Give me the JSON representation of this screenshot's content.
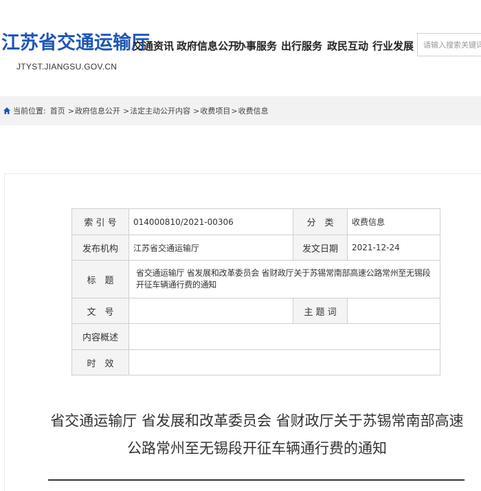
{
  "site": {
    "name": "江苏省交通运输厅",
    "domain": "JTYST.JIANGSU.GOV.CN"
  },
  "nav": {
    "items": [
      {
        "label": "交通资讯"
      },
      {
        "label": "政府信息公开"
      },
      {
        "label": "办事服务"
      },
      {
        "label": "出行服务"
      },
      {
        "label": "政民互动"
      },
      {
        "label": "行业发展"
      }
    ]
  },
  "search": {
    "placeholder": "请输入搜索关键词"
  },
  "breadcrumb": {
    "prefix": "当前位置:",
    "items": [
      "首页",
      "政府信息公开",
      "法定主动公开内容",
      "收费项目",
      "收费信息"
    ],
    "separator": ">"
  },
  "meta_table": {
    "index_label": "索 引 号",
    "index_value": "014000810/2021-00306",
    "category_label": "分　类",
    "category_value": "收费信息",
    "publisher_label": "发布机构",
    "publisher_value": "江苏省交通运输厅",
    "date_label": "发文日期",
    "date_value": "2021-12-24",
    "title_label": "标　题",
    "title_value": "省交通运输厅 省发展和改革委员会 省财政厅关于苏锡常南部高速公路常州至无锡段开征车辆通行费的通知",
    "docnum_label": "文　号",
    "docnum_value": "",
    "keywords_label": "主 题 词",
    "keywords_value": "",
    "summary_label": "内容概述",
    "summary_value": "",
    "validity_label": "时　效",
    "validity_value": ""
  },
  "article": {
    "title": "省交通运输厅 省发展和改革委员会 省财政厅关于苏锡常南部高速公路常州至无锡段开征车辆通行费的通知"
  },
  "colors": {
    "brand": "#1d56b8",
    "breadcrumb_bg": "#f2f2f2",
    "table_label_bg": "#f4f4f4"
  },
  "icons": {
    "breadcrumb": "home-icon"
  }
}
